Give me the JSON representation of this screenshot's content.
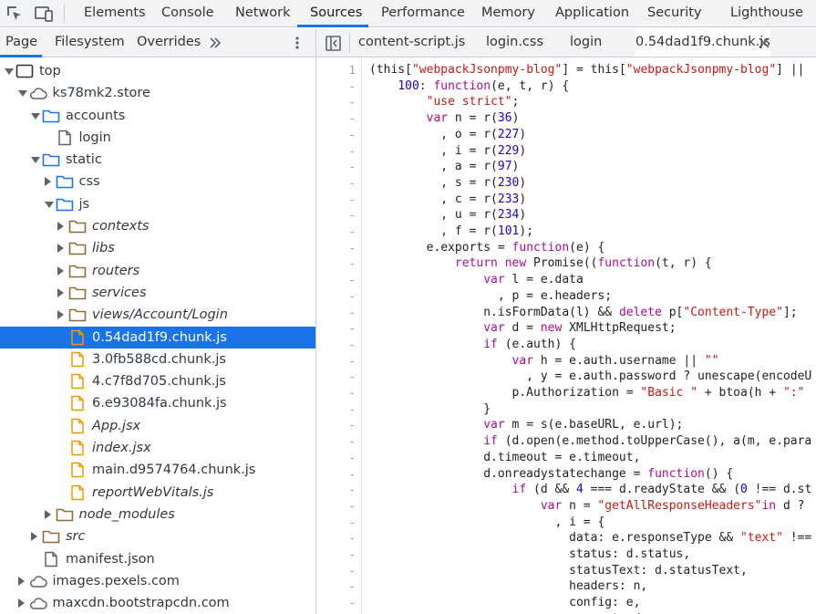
{
  "toolbar": {
    "tabs": [
      "Elements",
      "Console",
      "Network",
      "Sources",
      "Performance",
      "Memory",
      "Application",
      "Security",
      "Lighthouse"
    ],
    "active_tab": "Sources",
    "accent": "#1a73e8"
  },
  "navigator": {
    "tabs": [
      "Page",
      "Filesystem",
      "Overrides"
    ],
    "active_tab": "Page",
    "more_icon": "double-chevron-right-icon",
    "menu_icon": "kebab-menu-icon"
  },
  "editor": {
    "tabs": [
      "content-script.js",
      "login.css",
      "login",
      "0.54dad1f9.chunk.js"
    ],
    "active_tab": "0.54dad1f9.chunk.js"
  },
  "tree": [
    {
      "label": "top",
      "depth": 0,
      "arrow": "down",
      "icon": "frame-icon",
      "italic": false
    },
    {
      "label": "ks78mk2.store",
      "depth": 1,
      "arrow": "down",
      "icon": "cloud-icon",
      "italic": false
    },
    {
      "label": "accounts",
      "depth": 2,
      "arrow": "down",
      "icon": "folder-icon",
      "italic": false
    },
    {
      "label": "login",
      "depth": 3,
      "arrow": "",
      "icon": "document-icon",
      "italic": false
    },
    {
      "label": "static",
      "depth": 2,
      "arrow": "down",
      "icon": "folder-icon",
      "italic": false
    },
    {
      "label": "css",
      "depth": 3,
      "arrow": "right",
      "icon": "folder-icon",
      "italic": false
    },
    {
      "label": "js",
      "depth": 3,
      "arrow": "down",
      "icon": "folder-icon",
      "italic": false
    },
    {
      "label": "contexts",
      "depth": 4,
      "arrow": "right",
      "icon": "folder-brown-icon",
      "italic": true
    },
    {
      "label": "libs",
      "depth": 4,
      "arrow": "right",
      "icon": "folder-brown-icon",
      "italic": true
    },
    {
      "label": "routers",
      "depth": 4,
      "arrow": "right",
      "icon": "folder-brown-icon",
      "italic": true
    },
    {
      "label": "services",
      "depth": 4,
      "arrow": "right",
      "icon": "folder-brown-icon",
      "italic": true
    },
    {
      "label": "views/Account/Login",
      "depth": 4,
      "arrow": "right",
      "icon": "folder-brown-icon",
      "italic": true
    },
    {
      "label": "0.54dad1f9.chunk.js",
      "depth": 4,
      "arrow": "",
      "icon": "file-js-icon",
      "italic": false,
      "selected": true
    },
    {
      "label": "3.0fb588cd.chunk.js",
      "depth": 4,
      "arrow": "",
      "icon": "file-js-icon",
      "italic": false
    },
    {
      "label": "4.c7f8d705.chunk.js",
      "depth": 4,
      "arrow": "",
      "icon": "file-js-icon",
      "italic": false
    },
    {
      "label": "6.e93084fa.chunk.js",
      "depth": 4,
      "arrow": "",
      "icon": "file-js-icon",
      "italic": false
    },
    {
      "label": "App.jsx",
      "depth": 4,
      "arrow": "",
      "icon": "file-js-icon",
      "italic": true
    },
    {
      "label": "index.jsx",
      "depth": 4,
      "arrow": "",
      "icon": "file-js-icon",
      "italic": true
    },
    {
      "label": "main.d9574764.chunk.js",
      "depth": 4,
      "arrow": "",
      "icon": "file-js-icon",
      "italic": false
    },
    {
      "label": "reportWebVitals.js",
      "depth": 4,
      "arrow": "",
      "icon": "file-js-icon",
      "italic": true
    },
    {
      "label": "node_modules",
      "depth": 3,
      "arrow": "right",
      "icon": "folder-brown-icon",
      "italic": true
    },
    {
      "label": "src",
      "depth": 2,
      "arrow": "right",
      "icon": "folder-brown-icon",
      "italic": true
    },
    {
      "label": "manifest.json",
      "depth": 2,
      "arrow": "",
      "icon": "document-icon",
      "italic": false
    },
    {
      "label": "images.pexels.com",
      "depth": 1,
      "arrow": "right",
      "icon": "cloud-icon",
      "italic": false
    },
    {
      "label": "maxcdn.bootstrapcdn.com",
      "depth": 1,
      "arrow": "right",
      "icon": "cloud-icon",
      "italic": false
    }
  ],
  "code": {
    "line_numbers": [
      "1",
      "-",
      "-",
      "-",
      "-",
      "-",
      "-",
      "-",
      "-",
      "-",
      "-",
      "-",
      "-",
      "-",
      "-",
      "-",
      "-",
      "-",
      "-",
      "-",
      "-",
      "-",
      "-",
      "-",
      "-",
      "-",
      "-",
      "-",
      "-",
      "-",
      "-",
      "-",
      "-",
      "-"
    ],
    "lines": [
      [
        [
          "",
          "(this["
        ],
        [
          "s",
          "\"webpackJsonpmy-blog\""
        ],
        [
          "",
          "] = this["
        ],
        [
          "s",
          "\"webpackJsonpmy-blog\""
        ],
        [
          "",
          "] ||"
        ]
      ],
      [
        [
          "",
          "    "
        ],
        [
          "n",
          "100"
        ],
        [
          "",
          ": "
        ],
        [
          "k",
          "function"
        ],
        [
          "",
          "(e, t, r) {"
        ]
      ],
      [
        [
          "",
          "        "
        ],
        [
          "s",
          "\"use strict\""
        ],
        [
          "",
          ";"
        ]
      ],
      [
        [
          "",
          "        "
        ],
        [
          "k",
          "var"
        ],
        [
          "",
          " n = r("
        ],
        [
          "n",
          "36"
        ],
        [
          "",
          ")"
        ]
      ],
      [
        [
          "",
          "          , o = r("
        ],
        [
          "n",
          "227"
        ],
        [
          "",
          ")"
        ]
      ],
      [
        [
          "",
          "          , i = r("
        ],
        [
          "n",
          "229"
        ],
        [
          "",
          ")"
        ]
      ],
      [
        [
          "",
          "          , a = r("
        ],
        [
          "n",
          "97"
        ],
        [
          "",
          ")"
        ]
      ],
      [
        [
          "",
          "          , s = r("
        ],
        [
          "n",
          "230"
        ],
        [
          "",
          ")"
        ]
      ],
      [
        [
          "",
          "          , c = r("
        ],
        [
          "n",
          "233"
        ],
        [
          "",
          ")"
        ]
      ],
      [
        [
          "",
          "          , u = r("
        ],
        [
          "n",
          "234"
        ],
        [
          "",
          ")"
        ]
      ],
      [
        [
          "",
          "          , f = r("
        ],
        [
          "n",
          "101"
        ],
        [
          "",
          ");"
        ]
      ],
      [
        [
          "",
          "        e.exports = "
        ],
        [
          "k",
          "function"
        ],
        [
          "",
          "(e) {"
        ]
      ],
      [
        [
          "",
          "            "
        ],
        [
          "k",
          "return"
        ],
        [
          "",
          " "
        ],
        [
          "k",
          "new"
        ],
        [
          "",
          " Promise(("
        ],
        [
          "k",
          "function"
        ],
        [
          "",
          "(t, r) {"
        ]
      ],
      [
        [
          "",
          "                "
        ],
        [
          "k",
          "var"
        ],
        [
          "",
          " l = e.data"
        ]
      ],
      [
        [
          "",
          "                  , p = e.headers;"
        ]
      ],
      [
        [
          "",
          "                n.isFormData(l) && "
        ],
        [
          "k",
          "delete"
        ],
        [
          "",
          " p["
        ],
        [
          "s",
          "\"Content-Type\""
        ],
        [
          "",
          "];"
        ]
      ],
      [
        [
          "",
          "                "
        ],
        [
          "k",
          "var"
        ],
        [
          "",
          " d = "
        ],
        [
          "k",
          "new"
        ],
        [
          "",
          " XMLHttpRequest;"
        ]
      ],
      [
        [
          "",
          "                "
        ],
        [
          "k",
          "if"
        ],
        [
          "",
          " (e.auth) {"
        ]
      ],
      [
        [
          "",
          "                    "
        ],
        [
          "k",
          "var"
        ],
        [
          "",
          " h = e.auth.username || "
        ],
        [
          "s",
          "\"\""
        ]
      ],
      [
        [
          "",
          "                      , y = e.auth.password ? unescape(encodeU"
        ]
      ],
      [
        [
          "",
          "                    p.Authorization = "
        ],
        [
          "s",
          "\"Basic \""
        ],
        [
          "",
          " + btoa(h + "
        ],
        [
          "s",
          "\":\""
        ]
      ],
      [
        [
          "",
          "                }"
        ]
      ],
      [
        [
          "",
          "                "
        ],
        [
          "k",
          "var"
        ],
        [
          "",
          " m = s(e.baseURL, e.url);"
        ]
      ],
      [
        [
          "",
          "                "
        ],
        [
          "k",
          "if"
        ],
        [
          "",
          " (d.open(e.method.toUpperCase(), a(m, e.para"
        ]
      ],
      [
        [
          "",
          "                d.timeout = e.timeout,"
        ]
      ],
      [
        [
          "",
          "                d.onreadystatechange = "
        ],
        [
          "k",
          "function"
        ],
        [
          "",
          "() {"
        ]
      ],
      [
        [
          "",
          "                    "
        ],
        [
          "k",
          "if"
        ],
        [
          "",
          " (d && "
        ],
        [
          "n",
          "4"
        ],
        [
          "",
          " === d.readyState && ("
        ],
        [
          "n",
          "0"
        ],
        [
          "",
          " !== d.st"
        ]
      ],
      [
        [
          "",
          "                        "
        ],
        [
          "k",
          "var"
        ],
        [
          "",
          " n = "
        ],
        [
          "s",
          "\"getAllResponseHeaders\""
        ],
        [
          "k",
          "in"
        ],
        [
          "",
          " d ?"
        ]
      ],
      [
        [
          "",
          "                          , i = {"
        ]
      ],
      [
        [
          "",
          "                            data: e.responseType && "
        ],
        [
          "s",
          "\"text\""
        ],
        [
          "",
          " !=="
        ]
      ],
      [
        [
          "",
          "                            status: d.status,"
        ]
      ],
      [
        [
          "",
          "                            statusText: d.statusText,"
        ]
      ],
      [
        [
          "",
          "                            headers: n,"
        ]
      ],
      [
        [
          "",
          "                            config: e,"
        ]
      ],
      [
        [
          "",
          "                            request: d"
        ]
      ]
    ]
  }
}
